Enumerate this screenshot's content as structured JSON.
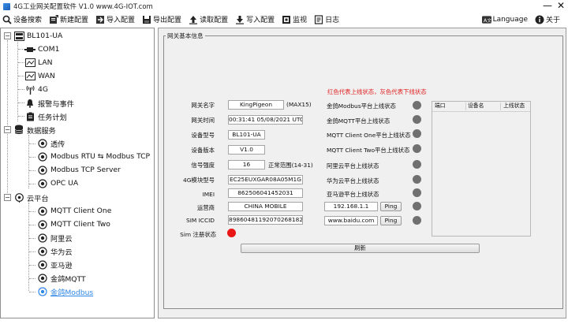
{
  "window": {
    "title": "4G工业网关配置软件 V1.0 www.4G-IOT.com",
    "minimize": "—",
    "close": "✕"
  },
  "toolbar": {
    "items": [
      {
        "label": "设备搜索",
        "icon": "search-icon"
      },
      {
        "label": "新建配置",
        "icon": "new-config-icon"
      },
      {
        "label": "导入配置",
        "icon": "import-icon"
      },
      {
        "label": "导出配置",
        "icon": "export-icon"
      },
      {
        "label": "读取配置",
        "icon": "read-config-icon"
      },
      {
        "label": "写入配置",
        "icon": "write-config-icon"
      },
      {
        "label": "监视",
        "icon": "monitor-icon"
      },
      {
        "label": "日志",
        "icon": "log-icon"
      }
    ],
    "language": "Language",
    "about": "关于"
  },
  "tree": {
    "root": "BL101-UA",
    "items": {
      "com1": "COM1",
      "lan": "LAN",
      "wan": "WAN",
      "g4": "4G",
      "alarm": "报警与事件",
      "task": "任务计划",
      "dataservice": "数据服务",
      "transparent": "透传",
      "modbus_rtu": "Modbus RTU ⇆ Modbus TCP",
      "modbus_tcp": "Modbus TCP Server",
      "opcua": "OPC UA",
      "cloud": "云平台",
      "mqtt1": "MQTT Client One",
      "mqtt2": "MQTT Client Two",
      "aliyun": "阿里云",
      "huawei": "华为云",
      "aws": "亚马逊",
      "jingemqtt": "金鸽MQTT",
      "jingemodbus": "金鸽Modbus"
    }
  },
  "group": {
    "title": "网关基本信息",
    "note": "红色代表上线状态，灰色代表下线状态"
  },
  "fields": {
    "gateway_name": {
      "label": "网关名字",
      "value": "KingPigeon",
      "suffix": "(MAX15)"
    },
    "gateway_time": {
      "label": "网关时间",
      "value": "00:31:41 05/08/2021 UTC"
    },
    "device_model": {
      "label": "设备型号",
      "value": "BL101-UA"
    },
    "device_version": {
      "label": "设备版本",
      "value": "V1.0"
    },
    "signal": {
      "label": "信号强度",
      "value": "16",
      "suffix": "正常范围(14-31)"
    },
    "module_model": {
      "label": "4G模块型号",
      "value": "EC25EUXGAR08A05M1G"
    },
    "imei": {
      "label": "IMEI",
      "value": "862506041452031"
    },
    "operator": {
      "label": "运营商",
      "value": "CHINA MOBILE"
    },
    "iccid": {
      "label": "SIM ICCID",
      "value": "89860481192070268182"
    },
    "sim_reg": {
      "label": "Sim 注册状态"
    }
  },
  "statuses": {
    "jinge_modbus": "金鸽Modbus平台上线状态",
    "jinge_mqtt": "金鸽MQTT平台上线状态",
    "mqtt_one": "MQTT Client One平台上线状态",
    "mqtt_two": "MQTT Client Two平台上线状态",
    "aliyun": "阿里云平台上线状态",
    "huawei": "华为云平台上线状态",
    "aws": "亚马逊平台上线状态"
  },
  "ping": {
    "ip": "192.168.1.1",
    "domain": "www.baidu.com",
    "button": "Ping"
  },
  "table": {
    "headers": [
      "端口",
      "设备名",
      "上线状态"
    ]
  },
  "refresh_label": "刷新",
  "colors": {
    "online": "#ea1515",
    "offline": "#707070",
    "selected": "#2f87e8"
  }
}
